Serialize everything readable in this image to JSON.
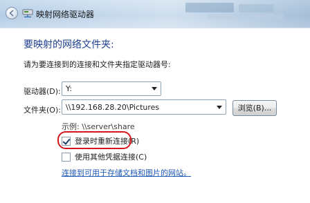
{
  "window": {
    "title": "映射网络驱动器"
  },
  "main": {
    "heading": "要映射的网络文件夹:",
    "subtitle": "请为要连接到的连接和文件夹指定驱动器号:",
    "drive": {
      "label": "驱动器(D):",
      "value": "Y:"
    },
    "folder": {
      "label": "文件夹(O):",
      "value": "\\\\192.168.28.20\\Pictures"
    },
    "browse_label": "浏览(B)...",
    "example": "示例: \\\\server\\share",
    "reconnect": {
      "label": "登录时重新连接(R)",
      "checked": true
    },
    "other_credentials": {
      "label": "使用其他凭据连接(C)",
      "checked": false
    },
    "link": "连接到可用于存储文档和图片的网站。"
  },
  "colors": {
    "heading": "#1d3f8f",
    "link": "#1f59b8",
    "highlight": "#d6141b"
  },
  "icons": {
    "back": "back-arrow-icon",
    "network_drive": "network-drive-icon"
  }
}
